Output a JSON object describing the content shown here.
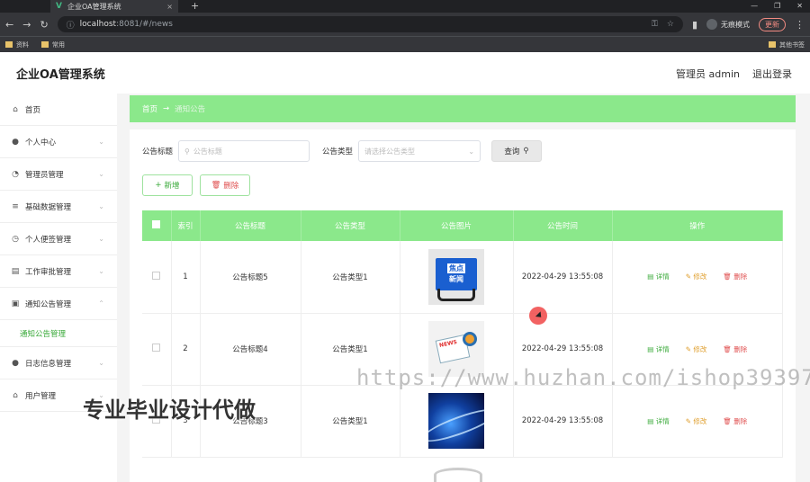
{
  "browser": {
    "tab_title": "企业OA管理系统",
    "new_tab": "+",
    "url_host": "localhost",
    "url_rest": ":8081/#/news",
    "profile_label": "无痕模式",
    "update_label": "更新",
    "bookmarks": [
      "资料",
      "常用"
    ],
    "bookmark_right": "其他书签"
  },
  "header": {
    "brand": "企业OA管理系统",
    "user": "管理员 admin",
    "logout": "退出登录"
  },
  "sidebar": {
    "items": [
      {
        "label": "首页",
        "icon": "home-icon"
      },
      {
        "label": "个人中心",
        "icon": "user-icon"
      },
      {
        "label": "管理员管理",
        "icon": "gauge-icon"
      },
      {
        "label": "基础数据管理",
        "icon": "layers-icon"
      },
      {
        "label": "个人便签管理",
        "icon": "clock-icon"
      },
      {
        "label": "工作审批管理",
        "icon": "document-icon"
      },
      {
        "label": "通知公告管理",
        "icon": "video-icon"
      },
      {
        "label": "日志信息管理",
        "icon": "user-icon"
      },
      {
        "label": "用户管理",
        "icon": "bank-icon"
      }
    ],
    "sub_active": "通知公告管理"
  },
  "breadcrumb": {
    "home": "首页",
    "arrow": "→",
    "current": "通知公告"
  },
  "search": {
    "title_label": "公告标题",
    "title_placeholder": "公告标题",
    "type_label": "公告类型",
    "type_placeholder": "请选择公告类型",
    "query_button": "查询"
  },
  "actions": {
    "add": "新增",
    "delete": "删除"
  },
  "table": {
    "headers": [
      "索引",
      "公告标题",
      "公告类型",
      "公告图片",
      "公告时间",
      "操作"
    ],
    "rows": [
      {
        "index": "1",
        "title": "公告标题5",
        "type": "公告类型1",
        "time": "2022-04-29 13:55:08",
        "image_text": [
          "焦点",
          "新闻"
        ]
      },
      {
        "index": "2",
        "title": "公告标题4",
        "type": "公告类型1",
        "time": "2022-04-29 13:55:08",
        "image_text": [
          "NEWS"
        ]
      },
      {
        "index": "3",
        "title": "公告标题3",
        "type": "公告类型1",
        "time": "2022-04-29 13:55:08",
        "image_text": []
      }
    ],
    "op_labels": {
      "detail": "详情",
      "edit": "修改",
      "remove": "删除"
    }
  },
  "overlays": {
    "watermark": "https://www.huzhan.com/ishop39397",
    "promo": "专业毕业设计代做"
  }
}
